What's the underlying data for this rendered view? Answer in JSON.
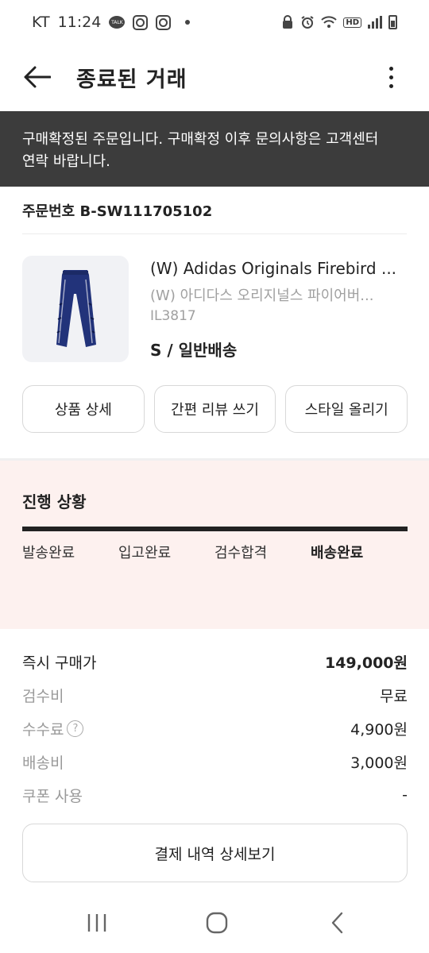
{
  "status_bar": {
    "carrier": "KT",
    "time": "11:24",
    "talk_icon_text": "TALK",
    "hd_label": "HD",
    "icons": [
      "talk-icon",
      "instagram-icon",
      "instagram-icon",
      "dot-icon",
      "lock-icon",
      "alarm-icon",
      "wifi-icon",
      "hd-icon",
      "signal-icon",
      "battery-icon"
    ]
  },
  "header": {
    "title": "종료된 거래",
    "back_icon": "arrow-left-icon",
    "more_icon": "more-vertical-icon"
  },
  "notice": {
    "line1": "구매확정된 주문입니다. 구매확정 이후 문의사항은 고객센터",
    "line2": "연락 바랍니다."
  },
  "order": {
    "number_label": "주문번호 B-SW111705102"
  },
  "product": {
    "name": "(W) Adidas Originals Firebird ...",
    "name_kr": "(W) 아디다스 오리지널스 파이어버...",
    "code": "IL3817",
    "option": "S / 일반배송",
    "image_icon": "track-pants-image"
  },
  "actions": [
    {
      "label": "상품 상세"
    },
    {
      "label": "간편 리뷰 쓰기"
    },
    {
      "label": "스타일 올리기"
    }
  ],
  "progress": {
    "title": "진행 상황",
    "fill_fraction": 1.0,
    "steps": [
      {
        "label": "발송완료",
        "active": false
      },
      {
        "label": "입고완료",
        "active": false
      },
      {
        "label": "검수합격",
        "active": false
      },
      {
        "label": "배송완료",
        "active": true
      }
    ]
  },
  "price": {
    "rows": [
      {
        "label": "즉시 구매가",
        "value": "149,000원"
      },
      {
        "label": "검수비",
        "value": "무료"
      },
      {
        "label": "수수료",
        "value": "4,900원",
        "help": "?"
      },
      {
        "label": "배송비",
        "value": "3,000원"
      },
      {
        "label": "쿠폰 사용",
        "value": "-"
      }
    ]
  },
  "detail_button": {
    "label": "결제 내역 상세보기"
  },
  "nav": {
    "icons": [
      "recent-apps-icon",
      "home-icon",
      "back-icon"
    ]
  },
  "colors": {
    "notice_bg": "#3c3c3c",
    "progress_bg": "#fdf1ef",
    "text_primary": "#222222",
    "text_secondary": "#a0a0a0",
    "product_navy": "#22337a"
  }
}
